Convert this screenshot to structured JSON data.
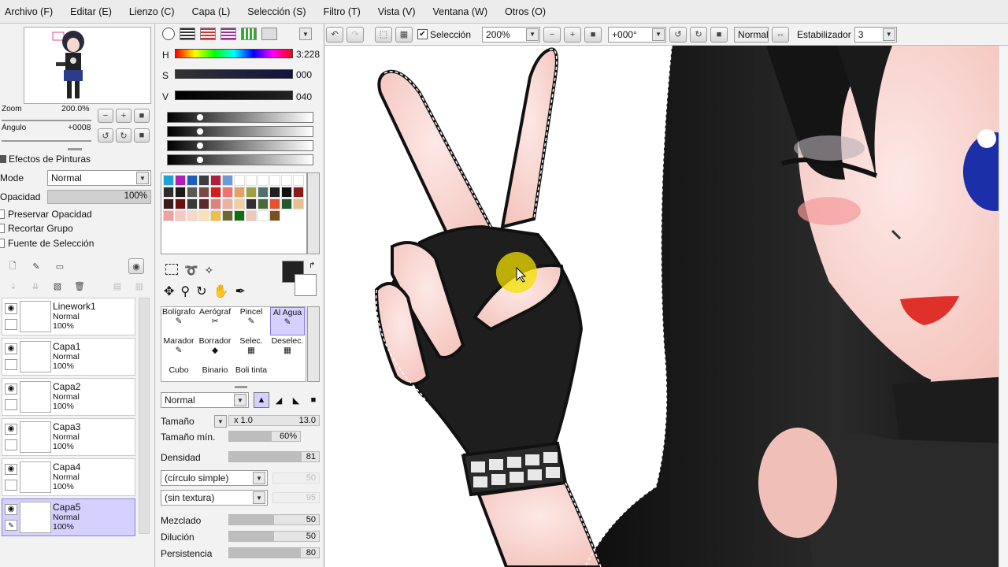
{
  "menu": [
    "Archivo (F)",
    "Editar (E)",
    "Lienzo (C)",
    "Capa (L)",
    "Selección (S)",
    "Filtro (T)",
    "Vista (V)",
    "Ventana (W)",
    "Otros (O)"
  ],
  "navigator": {
    "zoom_label": "Zoom",
    "zoom_value": "200.0%",
    "angle_label": "Ángulo",
    "angle_value": "+0008"
  },
  "layer_panel": {
    "effects_label": "Efectos de Pinturas",
    "mode_label": "Mode",
    "mode_value": "Normal",
    "opacity_label": "Opacidad",
    "opacity_value": "100%",
    "preserve_opacity": "Preservar Opacidad",
    "clip_group": "Recortar Grupo",
    "selection_source": "Fuente de Selección"
  },
  "layers": [
    {
      "name": "Linework1",
      "mode": "Normal",
      "opacity": "100%"
    },
    {
      "name": "Capa1",
      "mode": "Normal",
      "opacity": "100%"
    },
    {
      "name": "Capa2",
      "mode": "Normal",
      "opacity": "100%"
    },
    {
      "name": "Capa3",
      "mode": "Normal",
      "opacity": "100%"
    },
    {
      "name": "Capa4",
      "mode": "Normal",
      "opacity": "100%"
    },
    {
      "name": "Capa5",
      "mode": "Normal",
      "opacity": "100%"
    }
  ],
  "color": {
    "h_label": "H",
    "h_value": "3:228",
    "s_label": "S",
    "s_value": "000",
    "v_label": "V",
    "v_value": "040"
  },
  "swatches": [
    "#1fa3d6",
    "#b21fb4",
    "#1c5fbf",
    "#3c3c3c",
    "#b01e3c",
    "#6a9bd8",
    "#ffffff",
    "#ffffff",
    "#ffffff",
    "#ffffff",
    "#ffffff",
    "#ffffff",
    "#2e2e2e",
    "#1a1a1a",
    "#5a5a5a",
    "#7a4a4a",
    "#d41c1c",
    "#f07070",
    "#e8a060",
    "#a0a040",
    "#507070",
    "#202020",
    "#101010",
    "#8a1a1a",
    "#3a1a1a",
    "#6a1010",
    "#3a3a3a",
    "#5a2a2a",
    "#e08080",
    "#f0b0a0",
    "#f0d0a0",
    "#303030",
    "#4a6a3a",
    "#e85030",
    "#205a2a",
    "#e8c090",
    "#f0a0a0",
    "#f8c8c0",
    "#f8d8c8",
    "#ffe0b0",
    "#f0c040",
    "#6a6a30",
    "#107010",
    "#f0c8b8",
    "#ffffff",
    "#7a5020"
  ],
  "tools": {
    "row1": [
      "Bolígrafo",
      "Aerógraf",
      "Pincel",
      "Al Agua"
    ],
    "row2": [
      "Marador",
      "Borrador",
      "Selec.",
      "Deselec."
    ],
    "row3": [
      "Cubo",
      "Binario",
      "Boli tinta"
    ]
  },
  "brush": {
    "blend_mode": "Normal",
    "size_label": "Tamaño",
    "size_mult": "x 1.0",
    "size_value": "13.0",
    "min_size_label": "Tamaño mín.",
    "min_size_value": "60%",
    "density_label": "Densidad",
    "density_value": "81",
    "shape": "(círculo simple)",
    "shape_value": "50",
    "texture": "(sin textura)",
    "texture_value": "95",
    "blend_label": "Mezclado",
    "blend_value": "50",
    "dilution_label": "Dilución",
    "dilution_value": "50",
    "persistence_label": "Persistencia",
    "persistence_value": "80"
  },
  "toolbar": {
    "selection_label": "Selección",
    "zoom_value": "200%",
    "rotation_value": "+000°",
    "blend_mode": "Normal",
    "stabilizer_label": "Estabilizador",
    "stabilizer_value": "3"
  }
}
